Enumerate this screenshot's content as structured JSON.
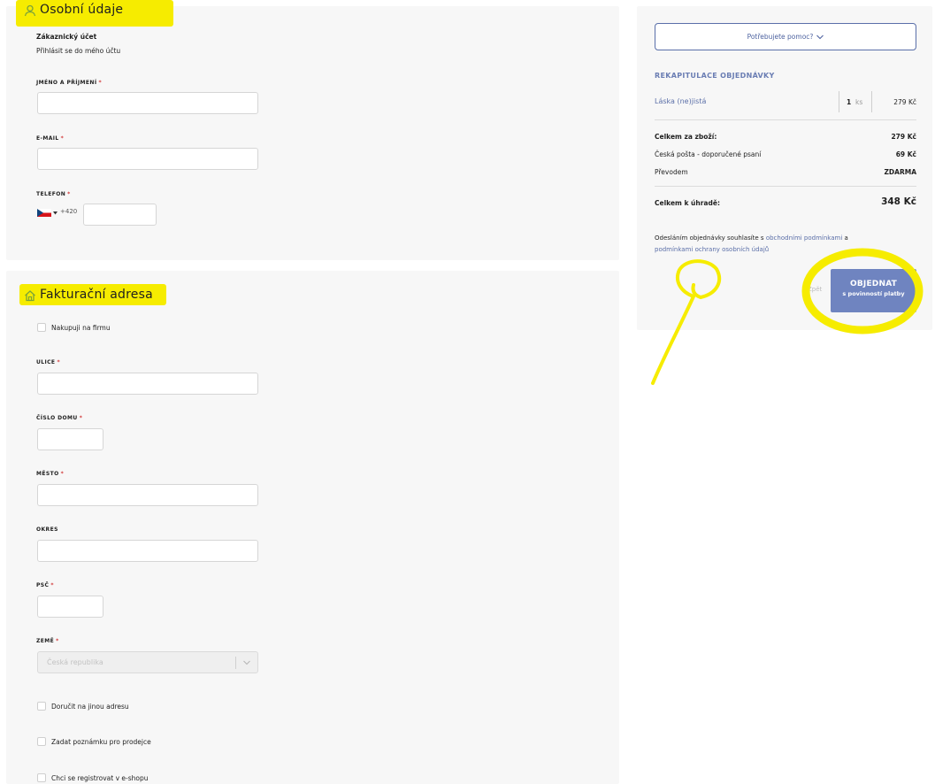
{
  "personal": {
    "title": "Osobní údaje",
    "account_title": "Zákaznický účet",
    "login_link": "Přihlásit se do mého účtu",
    "name_label": "JMÉNO A PŘÍJMENÍ",
    "email_label": "E-MAIL",
    "phone_label": "TELEFON",
    "phone_prefix": "+420",
    "required_mark": "*"
  },
  "billing": {
    "title": "Fakturační adresa",
    "company_checkbox": "Nakupuji na firmu",
    "street_label": "ULICE",
    "house_number_label": "ČÍSLO DOMU",
    "city_label": "MĚSTO",
    "district_label": "OKRES",
    "zip_label": "PSČ",
    "country_label": "ZEMĚ",
    "country_value": "Česká republika",
    "other_address_checkbox": "Doručit na jinou adresu",
    "note_checkbox": "Zadat poznámku pro prodejce",
    "register_checkbox": "Chci se registrovat v e-shopu"
  },
  "summary": {
    "help_button": "Potřebujete pomoc?",
    "recap_title": "REKAPITULACE OBJEDNÁVKY",
    "item_name": "Láska (ne)jistá",
    "item_qty": "1",
    "item_unit": "ks",
    "item_price": "279 Kč",
    "goods_total_label": "Celkem za zboží:",
    "goods_total_value": "279 Kč",
    "shipping_label": "Česká pošta - doporučené psaní",
    "shipping_value": "69 Kč",
    "payment_label": "Převodem",
    "payment_value": "ZDARMA",
    "grand_total_label": "Celkem k úhradě:",
    "grand_total_value": "348 Kč",
    "terms_text_1": "Odesláním objednávky souhlasíte s",
    "terms_link_1": "obchodními podmínkami",
    "terms_text_2": "a",
    "terms_link_2": "podmínkami ochrany osobních údajů",
    "back_link": "Zpět",
    "order_button_line1": "OBJEDNAT",
    "order_button_line2": "s povinností platby"
  },
  "colors": {
    "highlight": "#f6ec00",
    "accent": "#6f84c0",
    "link": "#5b6fa8",
    "required": "#d23a3a",
    "panel_bg": "#f7f7f7"
  },
  "icons": {
    "personal": "user-icon",
    "billing": "home-icon",
    "help": "chevron-down-icon",
    "country": "chevron-down-icon",
    "flag": "czech-flag-icon"
  }
}
